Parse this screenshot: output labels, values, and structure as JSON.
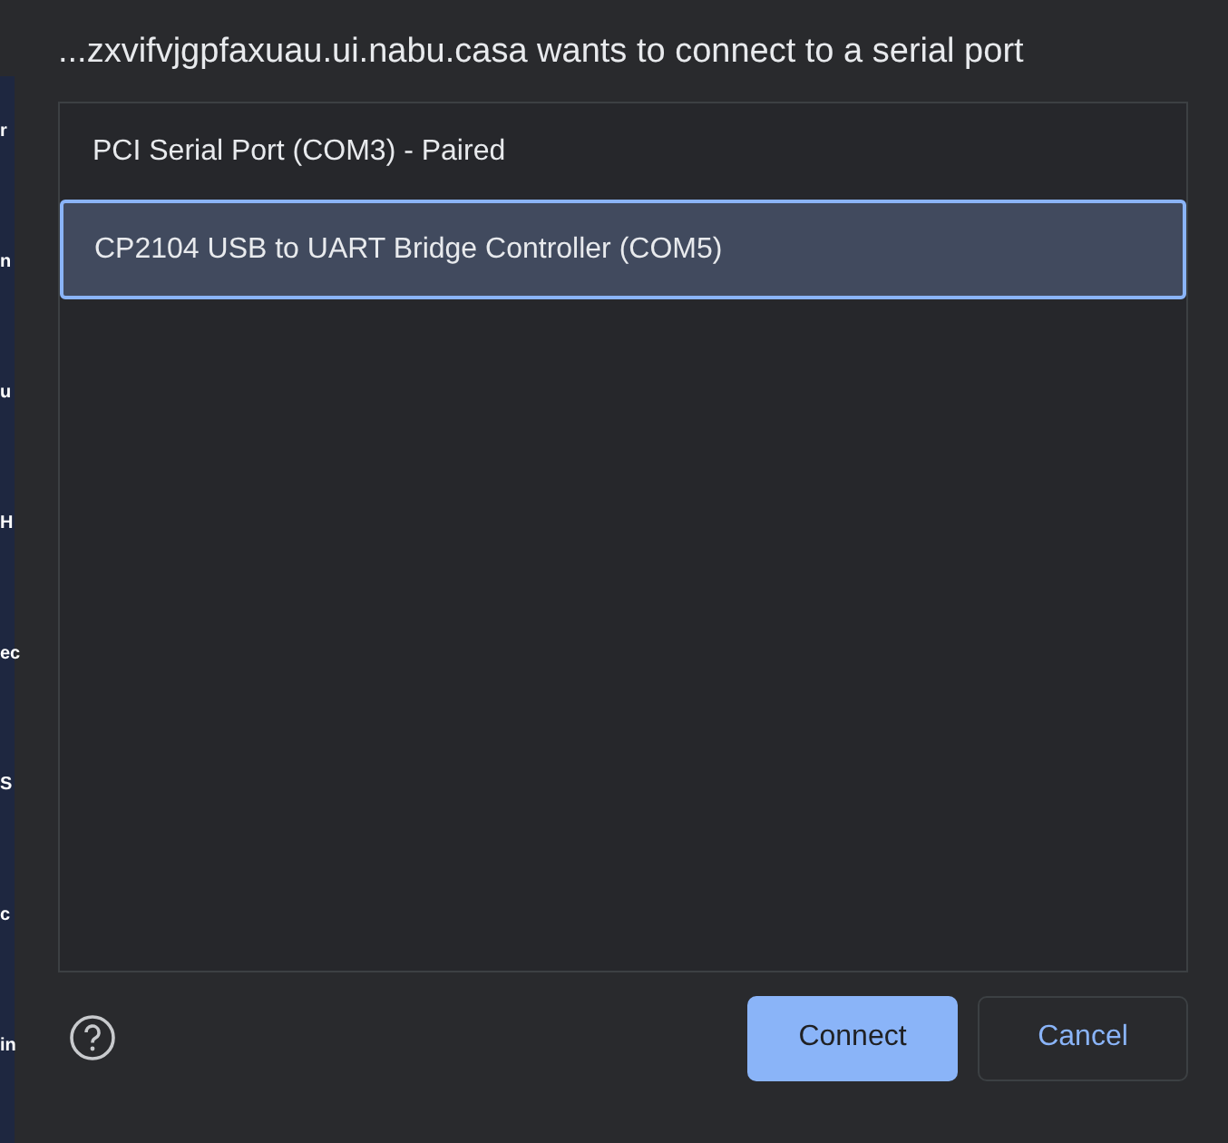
{
  "background_fragments": [
    "r",
    "n",
    "u",
    "H",
    "ec",
    "S",
    "c",
    "in"
  ],
  "dialog": {
    "title": "...zxvifvjgpfaxuau.ui.nabu.casa wants to connect to a serial port",
    "ports": [
      {
        "label": "PCI Serial Port (COM3) - Paired",
        "selected": false
      },
      {
        "label": "CP2104 USB to UART Bridge Controller (COM5)",
        "selected": true
      }
    ],
    "buttons": [
      {
        "label": "Connect",
        "kind": "primary"
      },
      {
        "label": "Cancel",
        "kind": "secondary"
      }
    ]
  }
}
